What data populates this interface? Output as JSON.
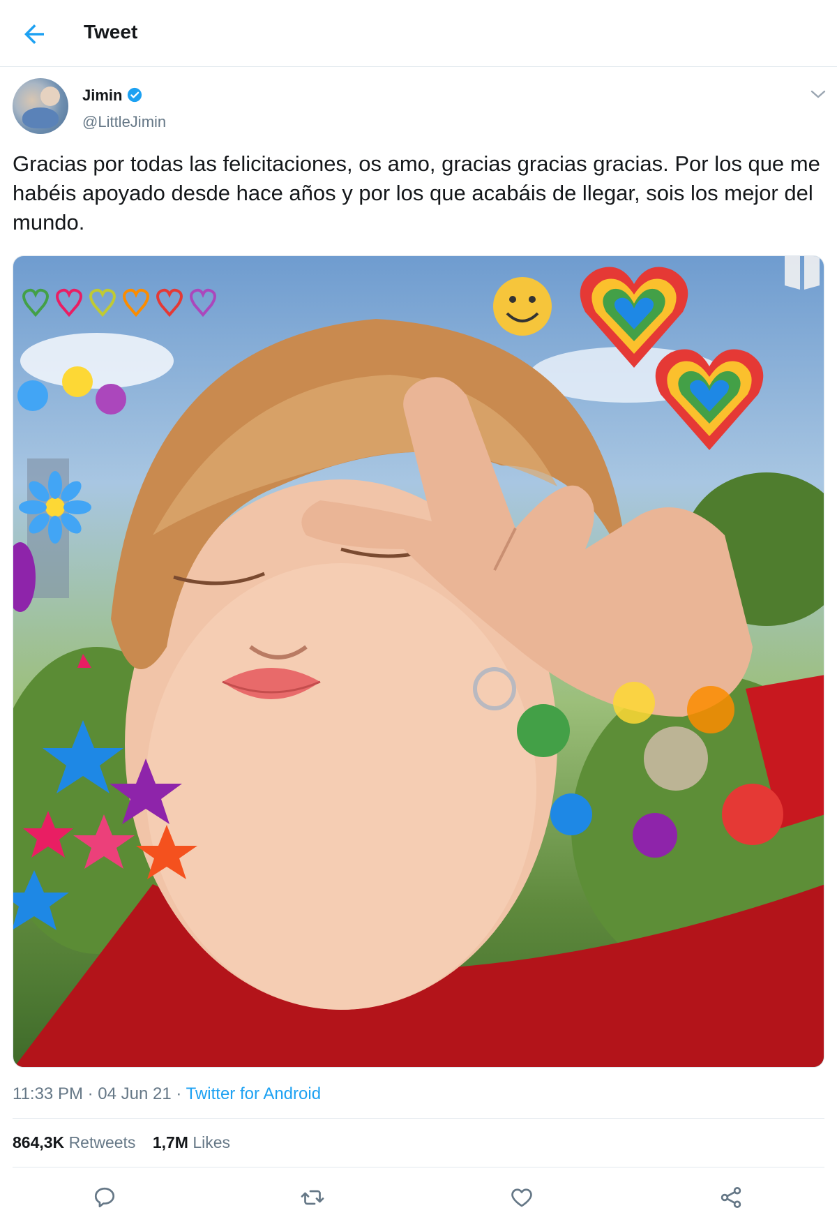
{
  "header": {
    "title": "Tweet",
    "back_icon": "back-arrow-icon"
  },
  "author": {
    "name": "Jimin",
    "handle": "@LittleJimin",
    "verified": true,
    "verified_icon": "verified-badge-icon"
  },
  "tweet": {
    "text": "Gracias por todas las felicitaciones, os amo, gracias gracias gracias. Por los que me habéis apoyado desde hace años y por los que acabáis de llegar, sois los mejor del mundo.",
    "time": "11:33 PM",
    "separator": "·",
    "date": "04 Jun 21",
    "source": "Twitter for Android"
  },
  "stats": {
    "retweets_count": "864,3K",
    "retweets_label": "Retweets",
    "likes_count": "1,7M",
    "likes_label": "Likes"
  },
  "actions": [
    "reply-icon",
    "retweet-icon",
    "like-icon",
    "share-icon"
  ],
  "colors": {
    "accent": "#1da1f2",
    "muted": "#657786",
    "divider": "#e1e8ed",
    "text": "#14171a"
  }
}
